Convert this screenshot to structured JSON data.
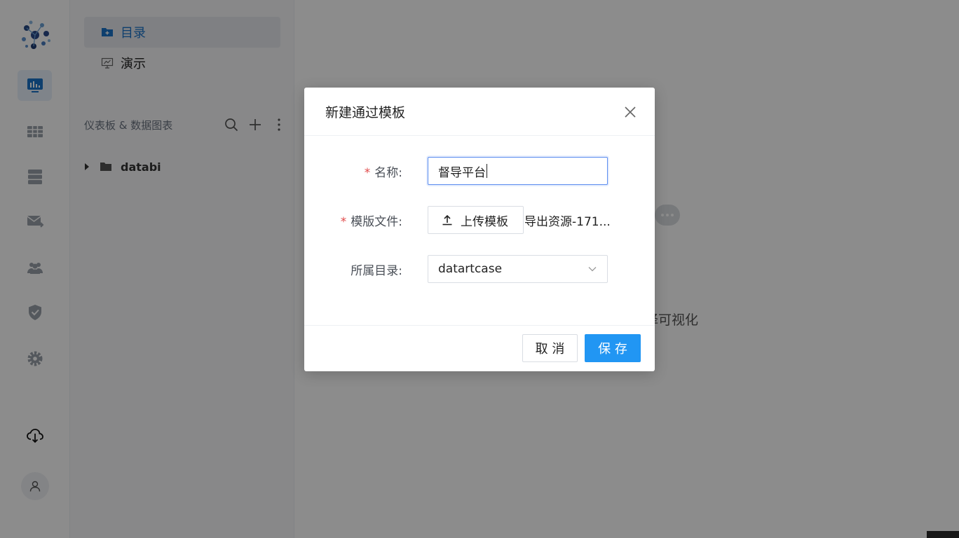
{
  "sidebar": {
    "nav": [
      {
        "label": "目录",
        "icon": "folder-plus-icon",
        "active": true
      },
      {
        "label": "演示",
        "icon": "presentation-icon",
        "active": false
      }
    ],
    "section_title": "仪表板 & 数据图表",
    "tree": [
      {
        "label": "databi",
        "icon": "folder-icon"
      }
    ]
  },
  "rail": {
    "items": [
      "dashboard-icon",
      "table-icon",
      "database-icon",
      "mail-forward-icon",
      "team-icon",
      "shield-check-icon",
      "gear-icon"
    ],
    "active_color": "#1a73c9"
  },
  "main": {
    "hint_text": "择可视化"
  },
  "modal": {
    "title": "新建通过模板",
    "fields": {
      "name": {
        "label": "名称:",
        "value": "督导平台",
        "required": true
      },
      "template": {
        "label": "模版文件:",
        "button_label": "上传模板",
        "file_name": "导出资源-171...",
        "required": true
      },
      "directory": {
        "label": "所属目录:",
        "value": "datartcase",
        "required": false
      }
    },
    "cancel_label": "取 消",
    "save_label": "保 存",
    "primary_color": "#2196f3"
  }
}
